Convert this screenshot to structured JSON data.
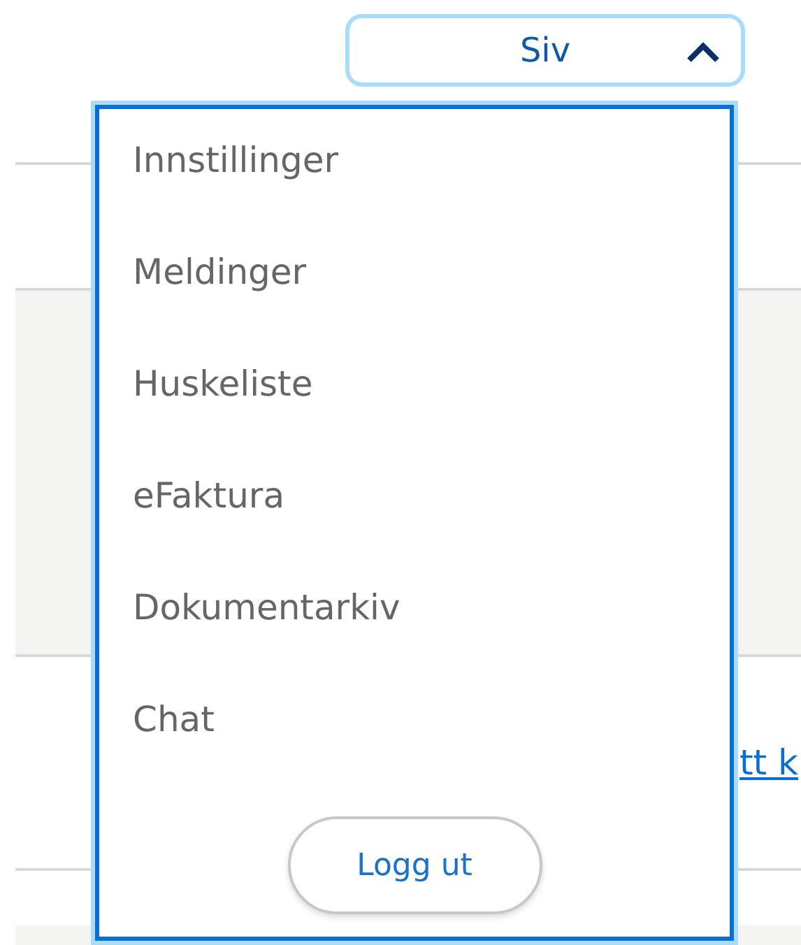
{
  "user_menu": {
    "label": "Siv",
    "expanded": true,
    "items": [
      {
        "label": "Innstillinger"
      },
      {
        "label": "Meldinger"
      },
      {
        "label": "Huskeliste"
      },
      {
        "label": "eFaktura"
      },
      {
        "label": "Dokumentarkiv"
      },
      {
        "label": "Chat"
      }
    ],
    "logout": "Logg ut"
  },
  "page": {
    "link": "tt k"
  }
}
